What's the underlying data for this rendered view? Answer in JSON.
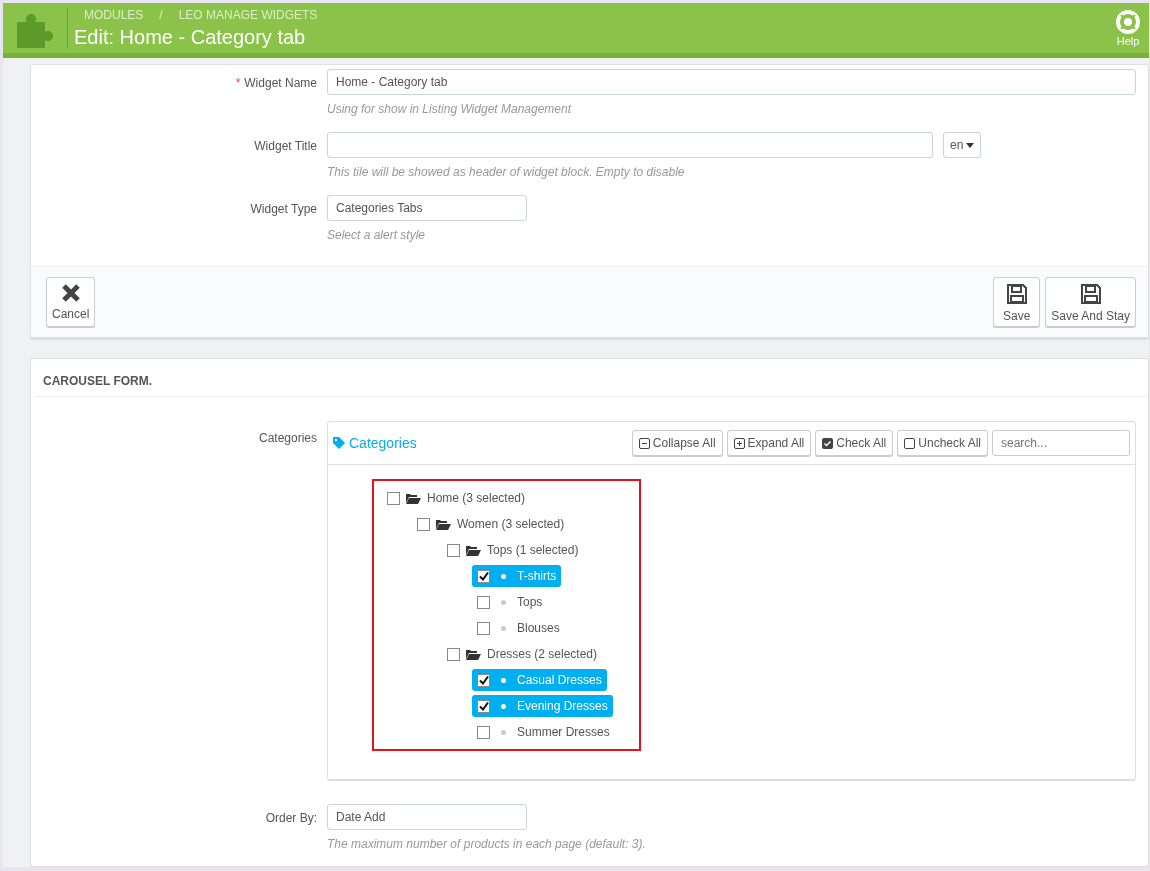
{
  "header": {
    "breadcrumb": [
      "MODULES",
      "LEO MANAGE WIDGETS"
    ],
    "breadcrumb_separator": "/",
    "title": "Edit: Home - Category tab",
    "help": "Help"
  },
  "widget_form": {
    "fields": [
      {
        "label": "Widget Name",
        "required_mark": "*",
        "kind": "text",
        "value": "Home - Category tab",
        "hint": "Using for show in Listing Widget Management"
      },
      {
        "label": "Widget Title",
        "kind": "text-lang",
        "lang": "en",
        "hint": "This tile will be showed as header of widget block. Empty to disable"
      },
      {
        "label": "Widget Type",
        "kind": "select",
        "value": "Categories Tabs",
        "hint": "Select a alert style"
      }
    ],
    "buttons": [
      {
        "label": "Cancel",
        "kind": "cancel"
      },
      {
        "label": "Save",
        "kind": "save"
      },
      {
        "label": "Save And Stay",
        "kind": "save"
      }
    ]
  },
  "carousel_form": {
    "title": "CAROUSEL FORM.",
    "categories_label": "Categories",
    "tree_title": "Categories",
    "tree_buttons": [
      {
        "label": "Collapse All",
        "kind": "collapse"
      },
      {
        "label": "Expand All",
        "kind": "expand"
      },
      {
        "label": "Check All",
        "kind": "check"
      },
      {
        "label": "Uncheck All",
        "kind": "uncheck"
      }
    ],
    "search": {
      "placeholder": "search..."
    },
    "tree": [
      {
        "label": "Home (3 selected)",
        "checked": false,
        "children": [
          {
            "label": "Women (3 selected)",
            "checked": false,
            "children": [
              {
                "label": "Tops (1 selected)",
                "checked": false,
                "children": [
                  {
                    "label": "T-shirts",
                    "checked": true
                  },
                  {
                    "label": "Tops",
                    "checked": false
                  },
                  {
                    "label": "Blouses",
                    "checked": false
                  }
                ]
              },
              {
                "label": "Dresses (2 selected)",
                "checked": false,
                "children": [
                  {
                    "label": "Casual Dresses",
                    "checked": true
                  },
                  {
                    "label": "Evening Dresses",
                    "checked": true
                  },
                  {
                    "label": "Summer Dresses",
                    "checked": false
                  }
                ]
              }
            ]
          }
        ]
      }
    ],
    "order_by": {
      "label": "Order By:",
      "value": "Date Add",
      "hint": "The maximum number of products in each page (default: 3)."
    }
  }
}
